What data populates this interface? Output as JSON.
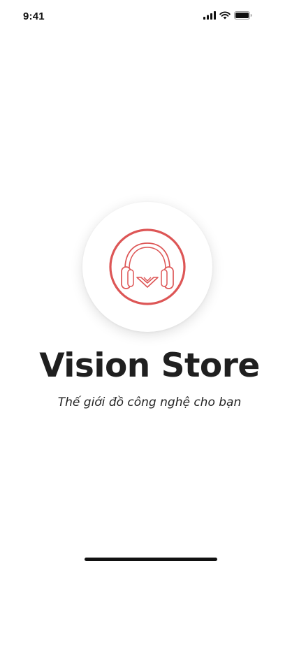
{
  "status_bar": {
    "time": "9:41",
    "icons": [
      "cellular-signal-icon",
      "wifi-icon",
      "battery-icon"
    ]
  },
  "logo": {
    "icon": "headphones-v-logo-icon",
    "accent_color": "#dd5656"
  },
  "brand": {
    "title": "Vision Store",
    "tagline": "Thế giới đồ công nghệ cho bạn"
  }
}
